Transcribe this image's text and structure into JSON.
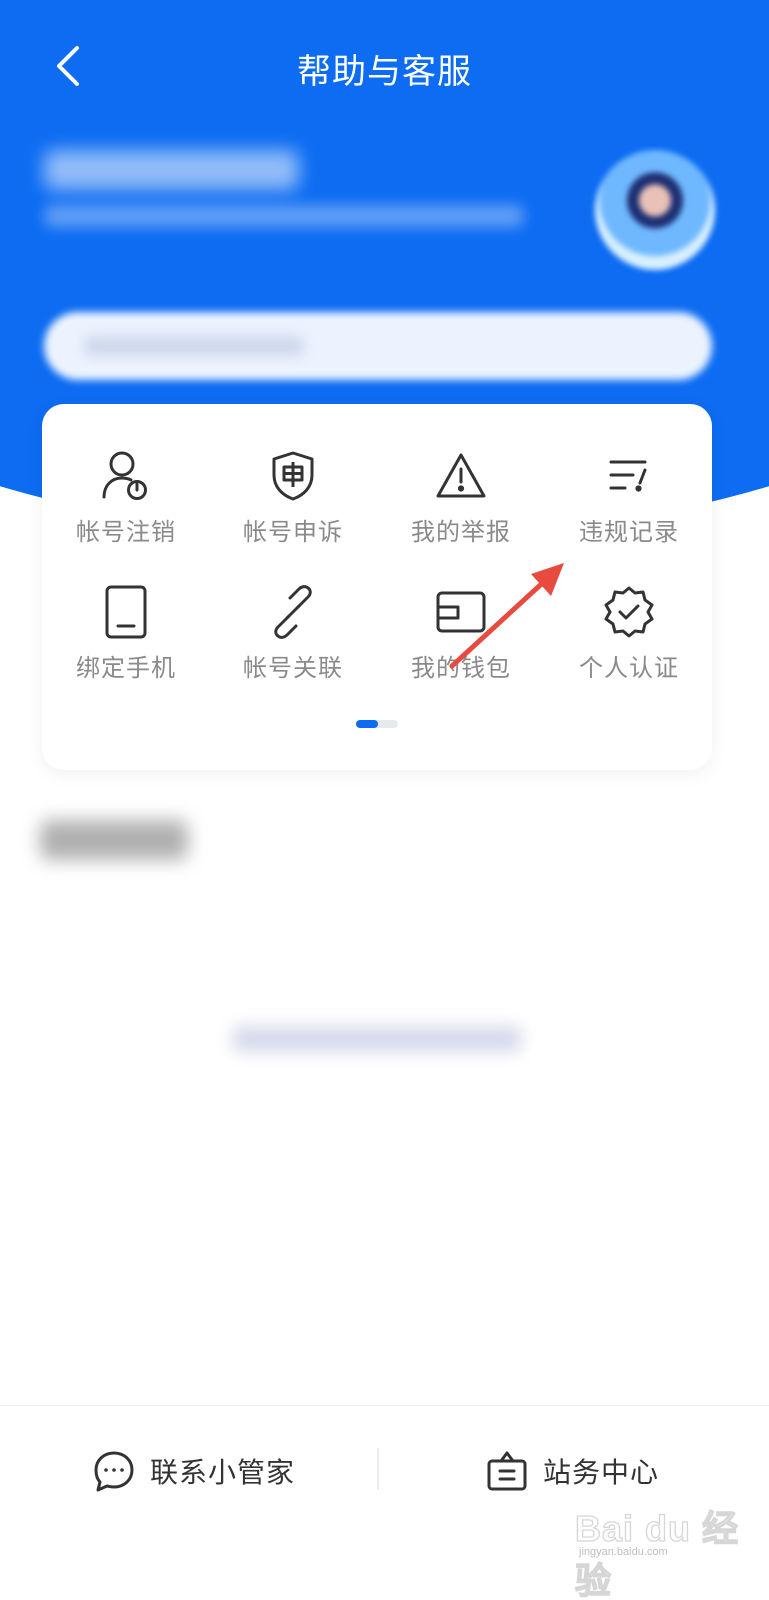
{
  "header": {
    "title": "帮助与客服",
    "background_color": "#0d6cf2"
  },
  "grid": {
    "items": [
      {
        "label": "帐号注销",
        "icon": "account-power-icon"
      },
      {
        "label": "帐号申诉",
        "icon": "shield-appeal-icon"
      },
      {
        "label": "我的举报",
        "icon": "warning-triangle-icon"
      },
      {
        "label": "违规记录",
        "icon": "violation-list-icon"
      },
      {
        "label": "绑定手机",
        "icon": "phone-icon"
      },
      {
        "label": "帐号关联",
        "icon": "link-icon"
      },
      {
        "label": "我的钱包",
        "icon": "wallet-icon"
      },
      {
        "label": "个人认证",
        "icon": "verified-badge-icon"
      }
    ],
    "page_indicator": {
      "current": 1,
      "total": 2
    }
  },
  "bottom_bar": {
    "contact_label": "联系小管家",
    "station_label": "站务中心"
  },
  "annotation": {
    "arrow_color": "#e84a3f"
  },
  "watermark": {
    "main": "Bai du 经验",
    "sub": "jingyan.baidu.com"
  }
}
